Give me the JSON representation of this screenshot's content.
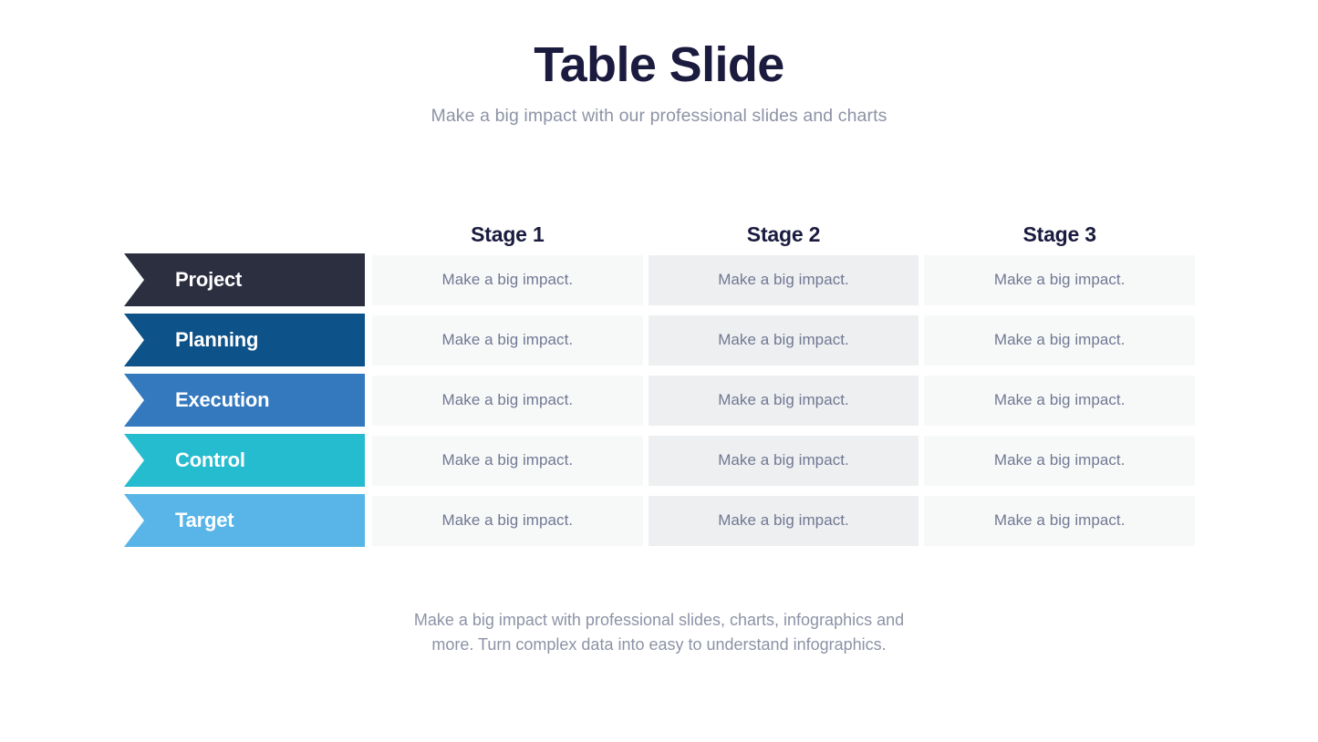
{
  "header": {
    "title": "Table Slide",
    "subtitle": "Make a big impact with our professional slides and charts"
  },
  "table": {
    "column_headers": [
      "Stage 1",
      "Stage 2",
      "Stage 3"
    ],
    "rows": [
      {
        "label": "Project",
        "color": "#2C2F40",
        "cells": [
          "Make a big impact.",
          "Make a big impact.",
          "Make a big impact."
        ]
      },
      {
        "label": "Planning",
        "color": "#0D5288",
        "cells": [
          "Make a big impact.",
          "Make a big impact.",
          "Make a big impact."
        ]
      },
      {
        "label": "Execution",
        "color": "#3478BE",
        "cells": [
          "Make a big impact.",
          "Make a big impact.",
          "Make a big impact."
        ]
      },
      {
        "label": "Control",
        "color": "#26BCD0",
        "cells": [
          "Make a big impact.",
          "Make a big impact.",
          "Make a big impact."
        ]
      },
      {
        "label": "Target",
        "color": "#59B5E8",
        "cells": [
          "Make a big impact.",
          "Make a big impact.",
          "Make a big impact."
        ]
      }
    ],
    "cell_shades": [
      "#F7F9F9",
      "#EDEFF1",
      "#F7F9F9"
    ]
  },
  "footer": {
    "line1": "Make a big impact with professional slides, charts, infographics and",
    "line2": "more. Turn complex data into easy to understand infographics."
  },
  "colors": {
    "title": "#1B1B3F",
    "muted_text": "#8D93A6",
    "cell_text": "#717892",
    "background": "#FFFFFF"
  }
}
